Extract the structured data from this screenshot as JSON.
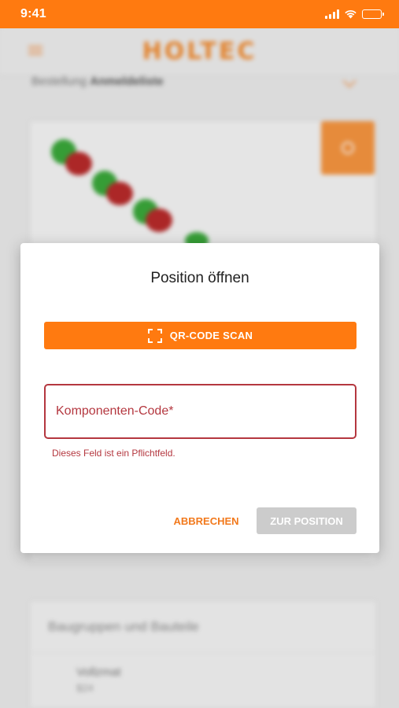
{
  "status_bar": {
    "time": "9:41",
    "icons": [
      "signal-icon",
      "wifi-icon",
      "battery-icon"
    ]
  },
  "background": {
    "brand": "HOLTEC",
    "section_label": "Bestellung",
    "section_value": "Anmeldeliste",
    "card_section_title": "Baugruppen und Bauteile",
    "row_title": "Vollzmat",
    "row_sub": "$24"
  },
  "dialog": {
    "title": "Position öffnen",
    "qr_button_label": "QR-CODE SCAN",
    "qr_icon": "qr-scan-icon",
    "field_placeholder": "Komponenten-Code*",
    "field_value": "",
    "field_error": "Dieses Feld ist ein Pflichtfeld.",
    "cancel_label": "ABBRECHEN",
    "submit_label": "ZUR POSITION"
  },
  "colors": {
    "accent": "#ff7a10",
    "error": "#b4373f",
    "disabled": "#cccccc"
  }
}
